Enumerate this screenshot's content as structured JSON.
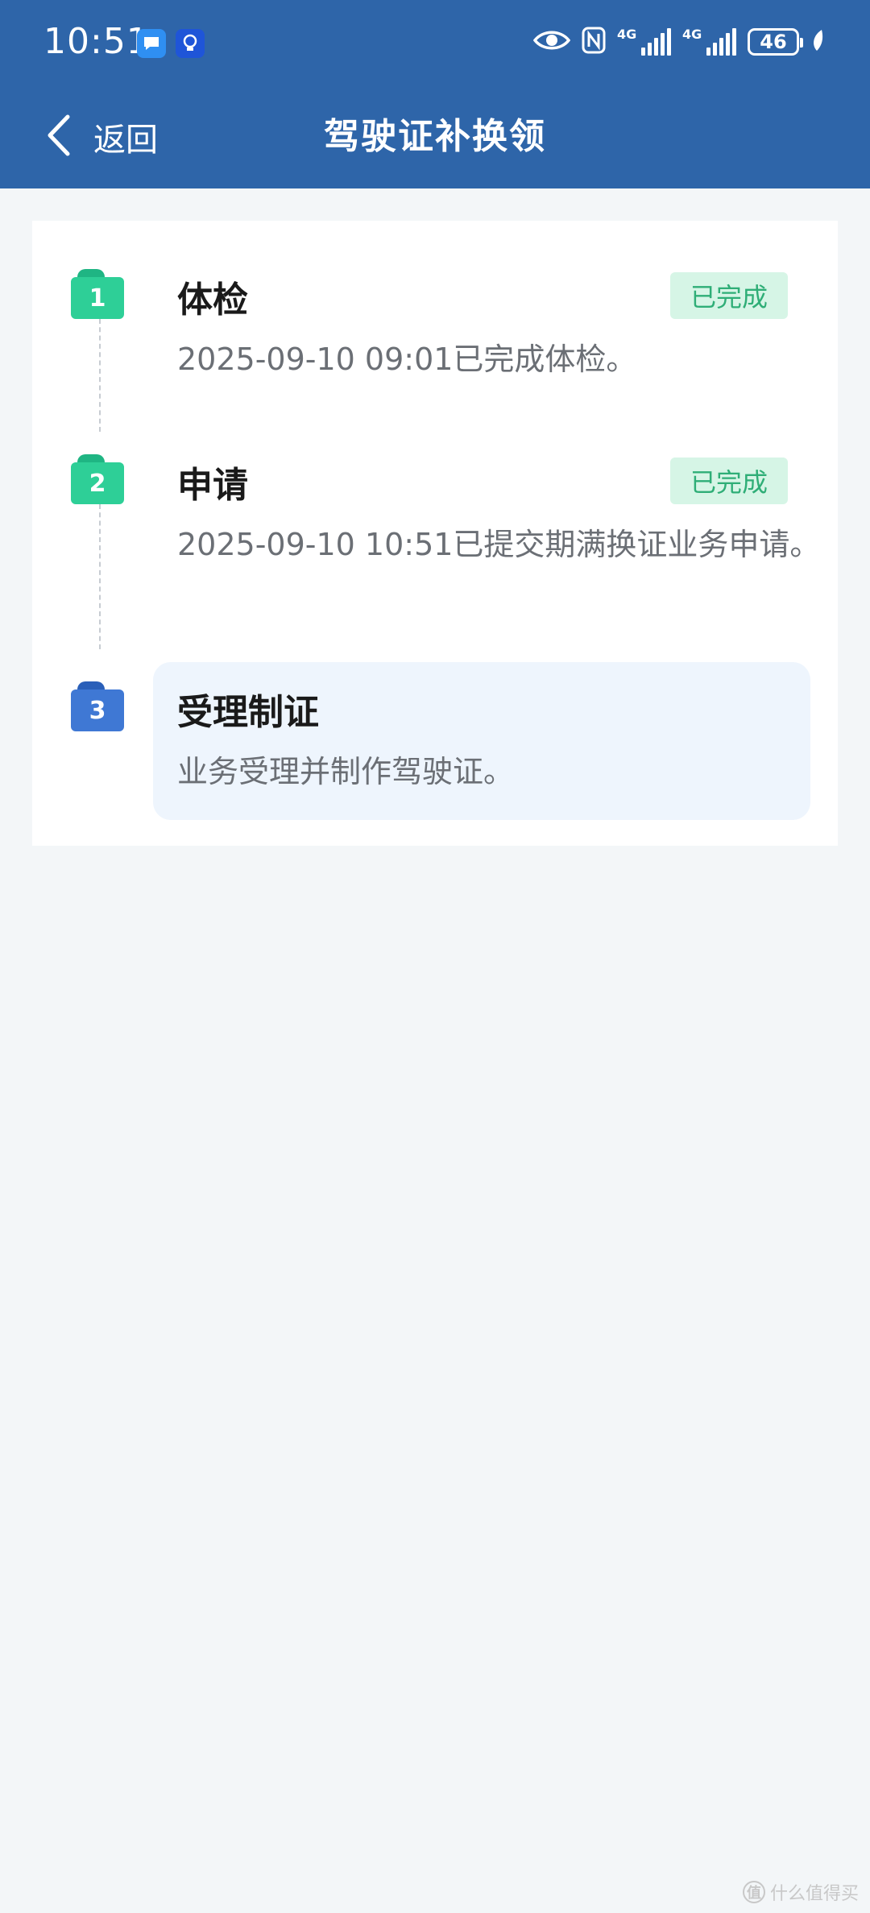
{
  "status_bar": {
    "time": "10:51",
    "net1": "4G",
    "net2": "4G",
    "battery": "46"
  },
  "header": {
    "back_label": "返回",
    "title": "驾驶证补换领"
  },
  "steps": [
    {
      "number": "1",
      "title": "体检",
      "status": "已完成",
      "description": "2025-09-10 09:01已完成体检。"
    },
    {
      "number": "2",
      "title": "申请",
      "status": "已完成",
      "description": "2025-09-10 10:51已提交期满换证业务申请。"
    },
    {
      "number": "3",
      "title": "受理制证",
      "description": "业务受理并制作驾驶证。"
    }
  ],
  "watermark": {
    "text": "什么值得买",
    "logo": "值"
  },
  "colors": {
    "header_bg": "#2e65a9",
    "completed_green": "#2ecf97",
    "current_blue": "#3f78d4",
    "badge_bg": "#d6f5e6",
    "badge_text": "#2fae77"
  }
}
